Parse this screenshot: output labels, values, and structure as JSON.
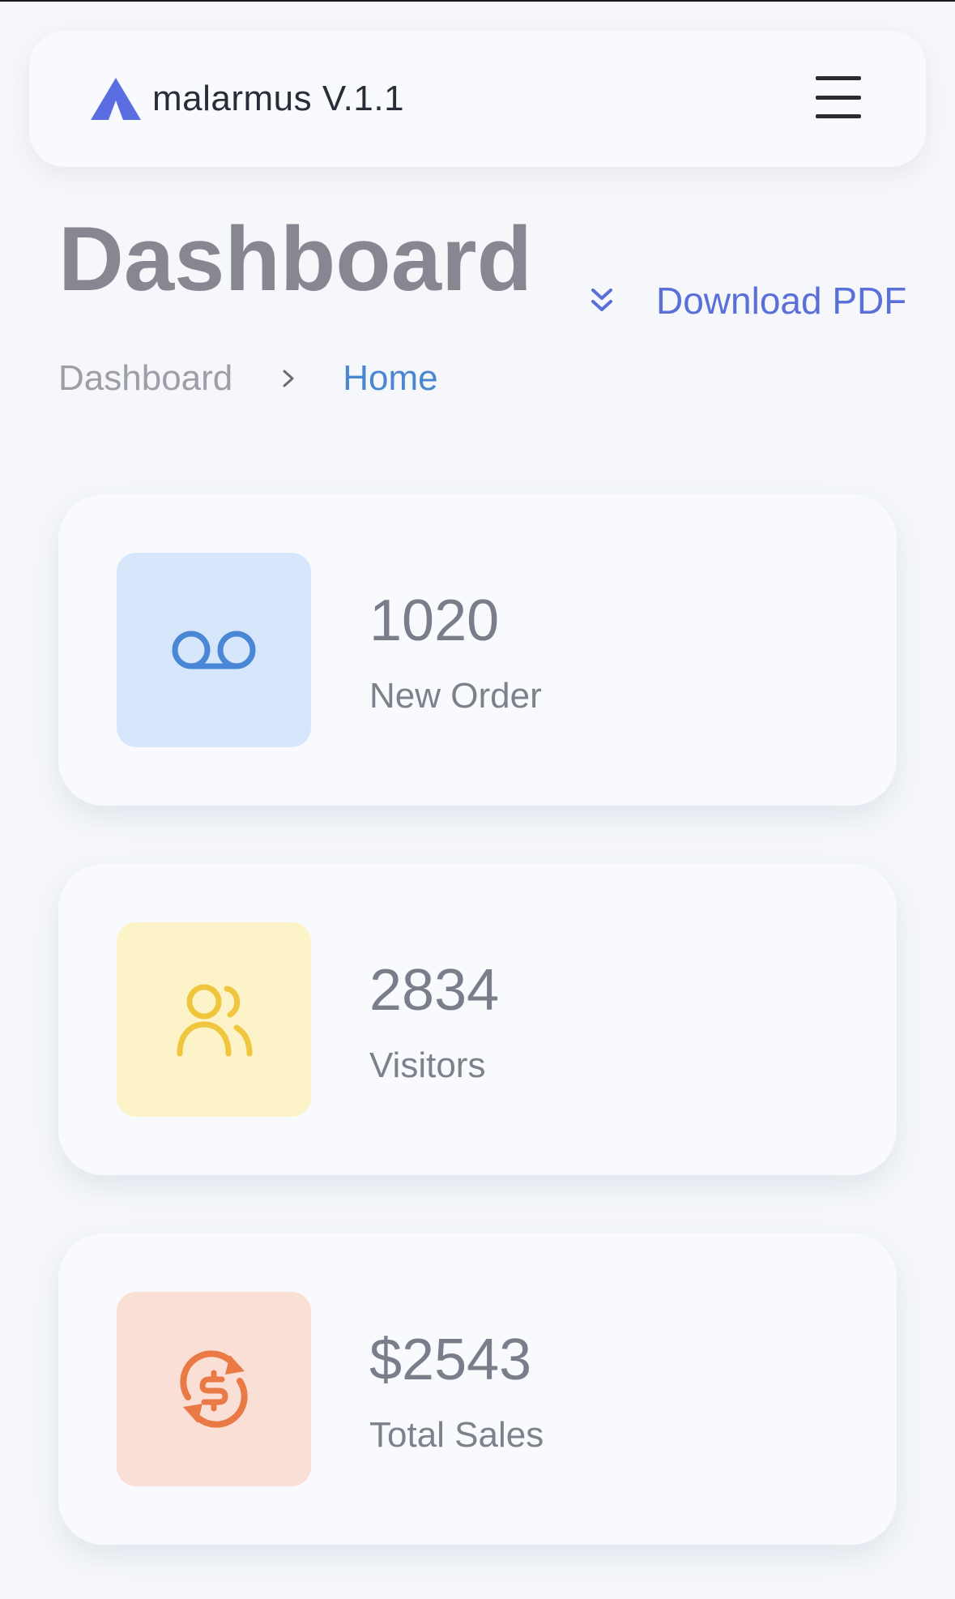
{
  "header": {
    "brand_name": "malarmus V.1.1",
    "logo_icon": "triangle-logo-icon",
    "menu_icon": "hamburger-menu-icon",
    "brand_color": "#5b6ee1"
  },
  "page": {
    "title": "Dashboard",
    "download_label": "Download PDF",
    "download_icon": "double-chevron-down-icon"
  },
  "breadcrumb": {
    "root": "Dashboard",
    "separator_icon": "chevron-right-icon",
    "current": "Home"
  },
  "stats": [
    {
      "value": "1020",
      "label": "New Order",
      "icon": "voicemail-icon",
      "icon_color": "#4a86d6",
      "tile_color": "#d7e7fb"
    },
    {
      "value": "2834",
      "label": "Visitors",
      "icon": "users-icon",
      "icon_color": "#f0c63e",
      "tile_color": "#fdf3c8"
    },
    {
      "value": "$2543",
      "label": "Total Sales",
      "icon": "currency-exchange-icon",
      "icon_color": "#ea7a45",
      "tile_color": "#f9dfd5"
    }
  ]
}
